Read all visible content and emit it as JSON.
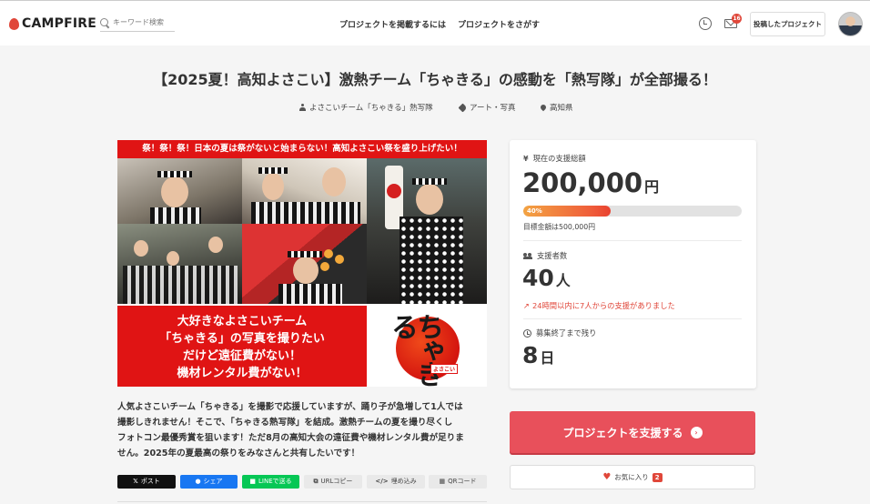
{
  "header": {
    "logo_text": "CAMPFIRE",
    "search_placeholder": "キーワード検索",
    "nav": [
      "プロジェクトを掲載するには",
      "プロジェクトをさがす"
    ],
    "mail_badge": "16",
    "posted_projects_label": "投稿したプロジェクト"
  },
  "project": {
    "title": "【2025夏！高知よさこい】激熱チーム「ちゃきる」の感動を「熱写隊」が全部撮る！",
    "owner": "よさこいチーム「ちゃきる」熱写隊",
    "category": "アート・写真",
    "location": "高知県"
  },
  "hero": {
    "banner": "祭！祭！祭！日本の夏は祭がないと始まらない！高知よさこい祭を盛り上げたい！",
    "lines": [
      "大好きなよさこいチーム",
      "「ちゃきる」の写真を撮りたい",
      "だけど遠征費がない！",
      "機材レンタル費がない！"
    ],
    "logo_text": "ちゃきる",
    "logo_tag": "よさこい"
  },
  "description": [
    "人気よさこいチーム「ちゃきる」を撮影で応援していますが、踊り子が急増して1人では",
    "撮影しきれません！そこで、「ちゃきる熱写隊」を結成。激熱チームの夏を撮り尽くし",
    "フォトコン最優秀賞を狙います！ただ8月の高知大会の遠征費や機材レンタル費が足りま",
    "せん。2025年の夏最高の祭りをみなさんと共有したいです！"
  ],
  "share": {
    "x": "ポスト",
    "facebook": "シェア",
    "line": "LINEで送る",
    "url": "URLコピー",
    "embed": "埋め込み",
    "qr": "QRコード"
  },
  "stats": {
    "funded_label": "現在の支援総額",
    "funded_amount": "200,000",
    "funded_unit": "円",
    "progress_percent": 40,
    "progress_label": "40%",
    "goal": "目標金額は500,000円",
    "backers_label": "支援者数",
    "backers_count": "40",
    "backers_unit": "人",
    "recent_activity": "24時間以内に7人からの支援がありました",
    "days_left_label": "募集終了まで残り",
    "days_left": "8",
    "days_unit": "日"
  },
  "actions": {
    "support_label": "プロジェクトを支援する",
    "favorite_label": "お気に入り",
    "favorite_count": "2"
  },
  "colors": {
    "brand_red": "#e0473a",
    "support_button": "#e8505b",
    "hero_red": "#e01414",
    "facebook": "#1877f2",
    "line": "#06c755"
  }
}
